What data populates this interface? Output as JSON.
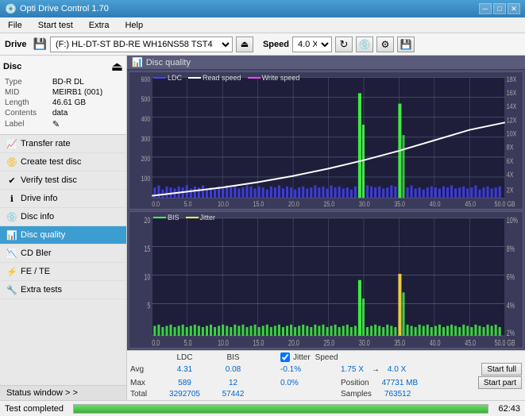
{
  "titleBar": {
    "title": "Opti Drive Control 1.70",
    "minBtn": "─",
    "maxBtn": "□",
    "closeBtn": "✕"
  },
  "menuBar": {
    "items": [
      "File",
      "Start test",
      "Extra",
      "Help"
    ]
  },
  "driveBar": {
    "driveLabel": "Drive",
    "driveValue": "(F:)  HL-DT-ST BD-RE  WH16NS58 TST4",
    "speedLabel": "Speed",
    "speedValue": "4.0 X"
  },
  "sidebar": {
    "discSection": "Disc",
    "discInfo": {
      "typeLabel": "Type",
      "typeValue": "BD-R DL",
      "midLabel": "MID",
      "midValue": "MEIRB1 (001)",
      "lengthLabel": "Length",
      "lengthValue": "46.61 GB",
      "contentsLabel": "Contents",
      "contentsValue": "data",
      "labelLabel": "Label",
      "labelValue": ""
    },
    "navItems": [
      {
        "id": "transfer-rate",
        "label": "Transfer rate",
        "active": false
      },
      {
        "id": "create-test-disc",
        "label": "Create test disc",
        "active": false
      },
      {
        "id": "verify-test-disc",
        "label": "Verify test disc",
        "active": false
      },
      {
        "id": "drive-info",
        "label": "Drive info",
        "active": false
      },
      {
        "id": "disc-info",
        "label": "Disc info",
        "active": false
      },
      {
        "id": "disc-quality",
        "label": "Disc quality",
        "active": true
      },
      {
        "id": "cd-bler",
        "label": "CD Bler",
        "active": false
      },
      {
        "id": "fe-te",
        "label": "FE / TE",
        "active": false
      },
      {
        "id": "extra-tests",
        "label": "Extra tests",
        "active": false
      }
    ],
    "statusWindow": "Status window > >"
  },
  "discQuality": {
    "title": "Disc quality",
    "chart1": {
      "legend": [
        {
          "label": "LDC",
          "color": "#4444ff"
        },
        {
          "label": "Read speed",
          "color": "white"
        },
        {
          "label": "Write speed",
          "color": "#ff44ff"
        }
      ],
      "yAxisLeft": [
        "600",
        "500",
        "400",
        "300",
        "200",
        "100",
        "0"
      ],
      "yAxisRight": [
        "18X",
        "16X",
        "14X",
        "12X",
        "10X",
        "8X",
        "6X",
        "4X",
        "2X"
      ],
      "xAxis": [
        "0.0",
        "5.0",
        "10.0",
        "15.0",
        "20.0",
        "25.0",
        "30.0",
        "35.0",
        "40.0",
        "45.0",
        "50.0 GB"
      ]
    },
    "chart2": {
      "legend": [
        {
          "label": "BIS",
          "color": "#44ff44"
        },
        {
          "label": "Jitter",
          "color": "#ffff44"
        }
      ],
      "yAxisLeft": [
        "20",
        "15",
        "10",
        "5",
        "0"
      ],
      "yAxisRight": [
        "10%",
        "8%",
        "6%",
        "4%",
        "2%"
      ],
      "xAxis": [
        "0.0",
        "5.0",
        "10.0",
        "15.0",
        "20.0",
        "25.0",
        "30.0",
        "35.0",
        "40.0",
        "45.0",
        "50.0 GB"
      ]
    }
  },
  "statsPanel": {
    "headers": [
      "LDC",
      "BIS",
      "",
      "Jitter",
      "Speed",
      ""
    ],
    "avgLabel": "Avg",
    "maxLabel": "Max",
    "totalLabel": "Total",
    "ldcAvg": "4.31",
    "ldcMax": "589",
    "ldcTotal": "3292705",
    "bisAvg": "0.08",
    "bisMax": "12",
    "bisTotal": "57442",
    "jitterAvg": "-0.1%",
    "jitterMax": "0.0%",
    "jitterTotal": "",
    "speedVal": "1.75 X",
    "speedMax": "4.0 X",
    "posLabel": "Position",
    "posVal": "47731 MB",
    "samplesLabel": "Samples",
    "samplesVal": "763512",
    "startFullBtn": "Start full",
    "startPartBtn": "Start part",
    "jitterChecked": true,
    "jitterLabel": "Jitter"
  },
  "statusBar": {
    "statusText": "Test completed",
    "progress": 100,
    "time": "62:43"
  }
}
